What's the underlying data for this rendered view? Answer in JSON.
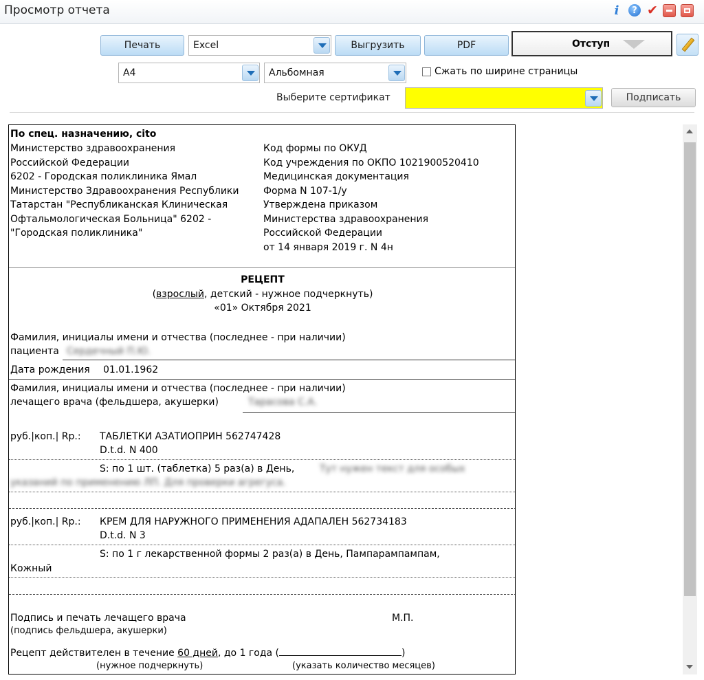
{
  "window": {
    "title": "Просмотр отчета"
  },
  "toolbar": {
    "print_label": "Печать",
    "format_value": "Excel",
    "export_label": "Выгрузить",
    "pdf_label": "PDF",
    "indent_label": "Отступ",
    "paper_value": "А4",
    "orientation_value": "Альбомная",
    "fit_width_label": "Сжать по ширине страницы",
    "fit_width_checked": false,
    "cert_label": "Выберите сертификат",
    "cert_value": "",
    "sign_label": "Подписать"
  },
  "report": {
    "urgency": "По спец. назначению, cito",
    "left_header": [
      "Министерство здравоохранения",
      "Российской Федерации",
      "6202 - Городская поликлиника Ямал",
      "Министерство Здравоохранения Республики",
      "Татарстан \"Республиканская Клиническая",
      "Офтальмологическая Больница\" 6202 -",
      "\"Городская поликлиника\""
    ],
    "right_header": [
      "Код формы по ОКУД",
      "Код учреждения по ОКПО 1021900520410",
      "Медицинская документация",
      "Форма N 107-1/у",
      "Утверждена приказом",
      "Министерства здравоохранения",
      "Российской Федерации",
      "от 14 января 2019 г. N 4н"
    ],
    "title": "РЕЦЕПТ",
    "patient_type_open": "(",
    "patient_type_adult": "взрослый",
    "patient_type_rest": ", детский - нужное подчеркнуть)",
    "date": "«01» Октября 2021",
    "patient_name_label_1": "Фамилия, инициалы имени и отчества (последнее - при наличии)",
    "patient_name_label_2": "пациента",
    "patient_name_value": "Сердечный П.Ю.",
    "birth_label": "Дата рождения",
    "birth_value": "01.01.1962",
    "doctor_label_1": "Фамилия, инициалы имени и отчества (последнее - при наличии)",
    "doctor_label_2": "лечащего врача (фельдшера, акушерки)",
    "doctor_value": "Тарасова С.А.",
    "rx1_prefix": "руб.|коп.| Rp.:",
    "rx1_name": "ТАБЛЕТКИ АЗАТИОПРИН 562747428",
    "rx1_dtd": "D.t.d. N 400",
    "rx1_sig": "S: по 1 шт. (таблетка) 5 раз(а) в День,",
    "rx1_sig_extra_1": "Тут нужен текст для особых",
    "rx1_sig_extra_2": "указаний по применению ЛП. Для проверки агрегуса.",
    "rx2_prefix": "руб.|коп.| Rp.:",
    "rx2_name": "КРЕМ ДЛЯ НАРУЖНОГО ПРИМЕНЕНИЯ АДАПАЛЕН 562734183",
    "rx2_dtd": "D.t.d. N 3",
    "rx2_sig": "S: по 1 г лекарственной формы 2 раз(а) в День, Пампарампампам,",
    "rx2_sig_2": "Кожный",
    "signature_label": "Подпись и печать лечащего врача",
    "signature_sub": "(подпись фельдшера, акушерки)",
    "stamp_label": "М.П.",
    "validity_prefix": "Рецепт действителен в течение ",
    "validity_days": "60 дней",
    "validity_suffix": ", до 1 года (",
    "validity_close": ")",
    "validity_note_1": "(нужное подчеркнуть)",
    "validity_note_2": "(указать количество месяцев)"
  }
}
